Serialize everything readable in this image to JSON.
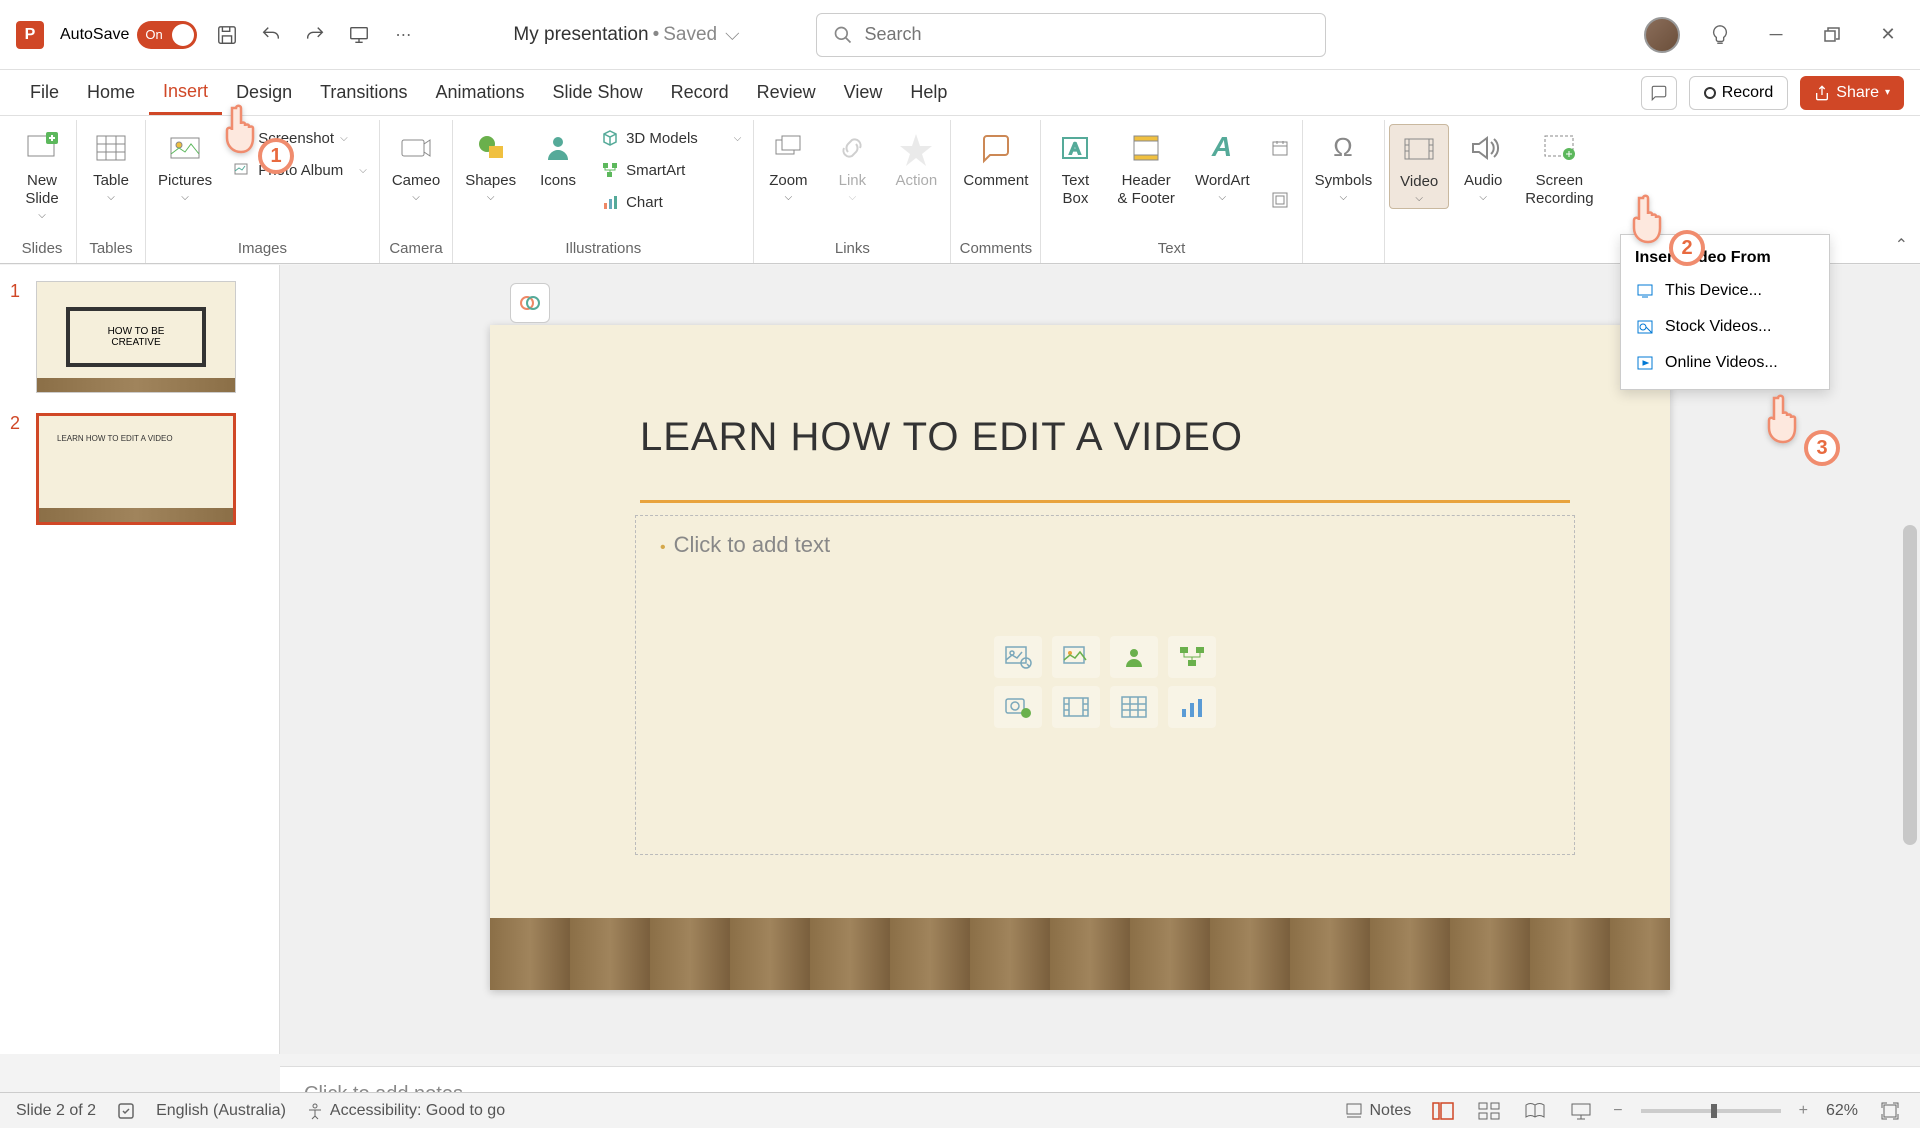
{
  "titlebar": {
    "autosave_label": "AutoSave",
    "autosave_state": "On",
    "doc_title": "My presentation",
    "doc_status": "Saved",
    "search_placeholder": "Search"
  },
  "tabs": {
    "file": "File",
    "home": "Home",
    "insert": "Insert",
    "design": "Design",
    "transitions": "Transitions",
    "animations": "Animations",
    "slideshow": "Slide Show",
    "record": "Record",
    "review": "Review",
    "view": "View",
    "help": "Help",
    "record_btn": "Record",
    "share_btn": "Share"
  },
  "ribbon": {
    "slides": {
      "new_slide": "New\nSlide",
      "group": "Slides"
    },
    "tables": {
      "table": "Table",
      "group": "Tables"
    },
    "images": {
      "pictures": "Pictures",
      "screenshot": "Screenshot",
      "photo_album": "Photo Album",
      "group": "Images"
    },
    "camera": {
      "cameo": "Cameo",
      "group": "Camera"
    },
    "illustrations": {
      "shapes": "Shapes",
      "icons": "Icons",
      "models3d": "3D Models",
      "smartart": "SmartArt",
      "chart": "Chart",
      "group": "Illustrations"
    },
    "links": {
      "zoom": "Zoom",
      "link": "Link",
      "action": "Action",
      "group": "Links"
    },
    "comments": {
      "comment": "Comment",
      "group": "Comments"
    },
    "text": {
      "textbox": "Text\nBox",
      "headerfooter": "Header\n& Footer",
      "wordart": "WordArt",
      "group": "Text"
    },
    "symbols": {
      "symbols": "Symbols"
    },
    "media": {
      "video": "Video",
      "audio": "Audio",
      "screen_recording": "Screen\nRecording"
    }
  },
  "video_menu": {
    "header": "Insert Video From",
    "this_device": "This Device...",
    "stock": "Stock Videos...",
    "online": "Online Videos..."
  },
  "thumbs": {
    "n1": "1",
    "n2": "2",
    "t1": "HOW TO BE\nCREATIVE",
    "t2": "LEARN HOW TO EDIT A VIDEO"
  },
  "slide": {
    "title": "LEARN HOW TO EDIT A VIDEO",
    "placeholder": "Click to add text"
  },
  "notes": {
    "placeholder": "Click to add notes"
  },
  "status": {
    "slide_info": "Slide 2 of 2",
    "language": "English (Australia)",
    "accessibility": "Accessibility: Good to go",
    "notes_btn": "Notes",
    "zoom": "62%"
  },
  "annotations": {
    "p1": "1",
    "p2": "2",
    "p3": "3"
  }
}
